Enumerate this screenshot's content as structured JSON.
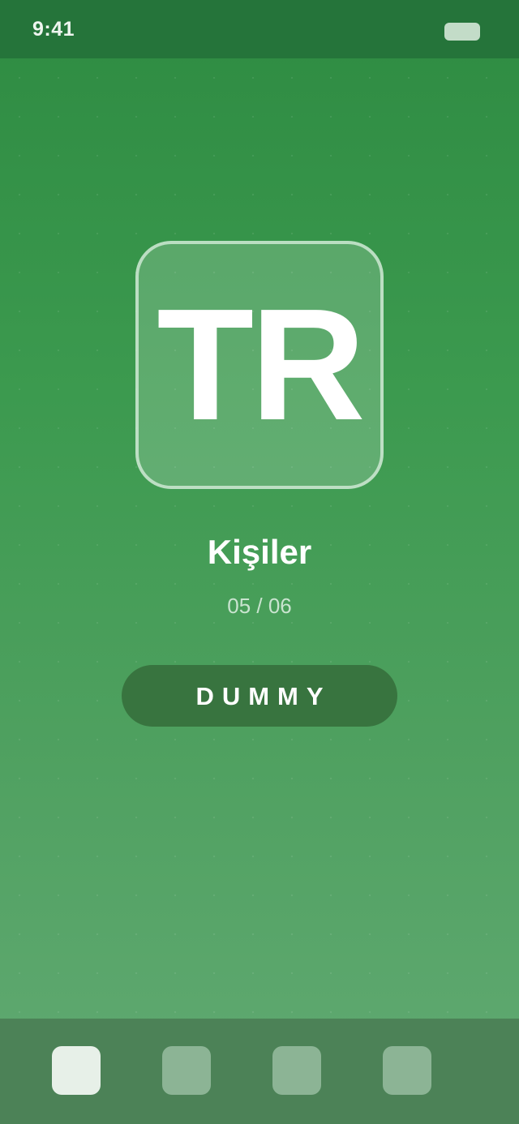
{
  "status_bar": {
    "time": "9:41",
    "battery_icon": "battery-icon"
  },
  "badge": {
    "text": "TR"
  },
  "title": "Kişiler",
  "progress": "05 / 06",
  "action_button_label": "DUMMY",
  "bottom_nav": {
    "active_index": 0,
    "tab_count": 4
  },
  "colors": {
    "background_top": "#2e8b42",
    "background_bottom": "#62aa73",
    "status_bar": "#25743a",
    "button": "#38743f",
    "bottom_bar": "#4c8257",
    "tab_active": "#e7f0e8",
    "tab_inactive": "#8cb495"
  }
}
